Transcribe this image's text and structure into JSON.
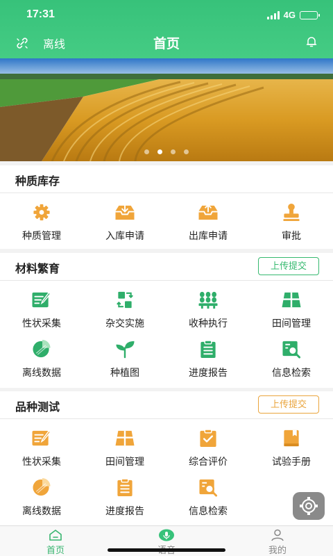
{
  "status_bar": {
    "time": "17:31",
    "network": "4G"
  },
  "nav": {
    "offline_label": "离线",
    "title": "首页"
  },
  "colors": {
    "primary_green": "#37c27a",
    "icon_orange": "#f0a53a",
    "icon_green": "#2fae6a"
  },
  "sections": [
    {
      "title": "种质库存",
      "upload_label": "",
      "items": [
        {
          "label": "种质管理",
          "icon": "gear-icon"
        },
        {
          "label": "入库申请",
          "icon": "inbox-in-icon"
        },
        {
          "label": "出库申请",
          "icon": "inbox-out-icon"
        },
        {
          "label": "审批",
          "icon": "stamp-icon"
        }
      ]
    },
    {
      "title": "材料繁育",
      "upload_label": "上传提交",
      "items": [
        {
          "label": "性状采集",
          "icon": "edit-note-icon"
        },
        {
          "label": "杂交实施",
          "icon": "exchange-icon"
        },
        {
          "label": "收种执行",
          "icon": "harvest-icon"
        },
        {
          "label": "田间管理",
          "icon": "field-grid-icon"
        },
        {
          "label": "离线数据",
          "icon": "pie-chart-icon"
        },
        {
          "label": "种植图",
          "icon": "sprout-icon"
        },
        {
          "label": "进度报告",
          "icon": "report-icon"
        },
        {
          "label": "信息检索",
          "icon": "search-doc-icon"
        }
      ]
    },
    {
      "title": "品种测试",
      "upload_label": "上传提交",
      "items": [
        {
          "label": "性状采集",
          "icon": "edit-note-icon"
        },
        {
          "label": "田间管理",
          "icon": "field-grid-icon"
        },
        {
          "label": "综合评价",
          "icon": "clipboard-check-icon"
        },
        {
          "label": "试验手册",
          "icon": "book-icon"
        },
        {
          "label": "离线数据",
          "icon": "pie-chart-icon"
        },
        {
          "label": "进度报告",
          "icon": "report-icon"
        },
        {
          "label": "信息检索",
          "icon": "search-doc-icon"
        }
      ]
    }
  ],
  "tabbar": {
    "items": [
      {
        "label": "首页"
      },
      {
        "label": "语音"
      },
      {
        "label": "我的"
      }
    ]
  }
}
